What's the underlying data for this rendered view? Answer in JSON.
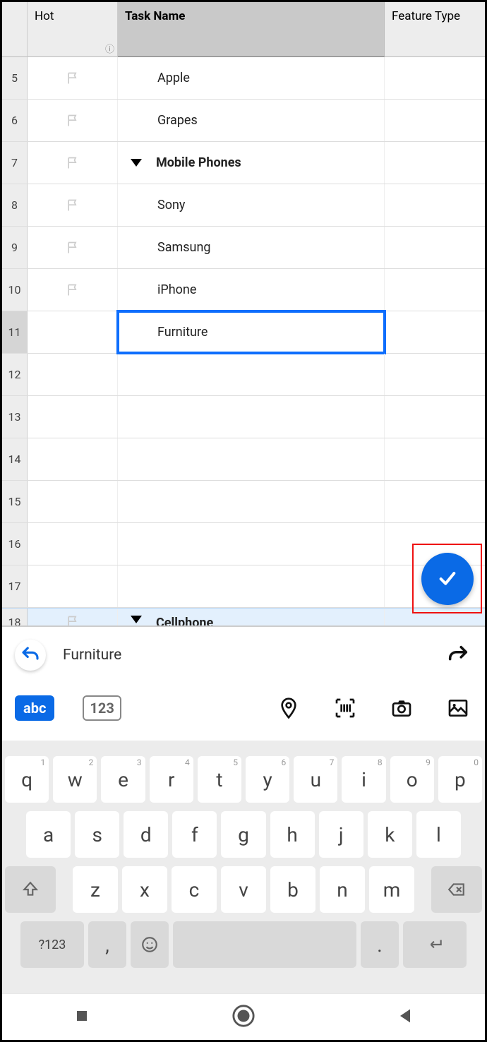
{
  "headers": {
    "hot": "Hot",
    "task": "Task Name",
    "feature": "Feature Type"
  },
  "rows": [
    {
      "num": "5",
      "flag": true,
      "indent": true,
      "text": "Apple"
    },
    {
      "num": "6",
      "flag": true,
      "indent": true,
      "text": "Grapes"
    },
    {
      "num": "7",
      "flag": true,
      "group": true,
      "text": "Mobile Phones"
    },
    {
      "num": "8",
      "flag": true,
      "indent": true,
      "text": "Sony"
    },
    {
      "num": "9",
      "flag": true,
      "indent": true,
      "text": "Samsung"
    },
    {
      "num": "10",
      "flag": true,
      "indent": true,
      "text": "iPhone"
    },
    {
      "num": "11",
      "flag": false,
      "indent": true,
      "text": "Furniture",
      "selected": true
    },
    {
      "num": "12",
      "text": ""
    },
    {
      "num": "13",
      "text": ""
    },
    {
      "num": "14",
      "text": ""
    },
    {
      "num": "15",
      "text": ""
    },
    {
      "num": "16",
      "text": ""
    },
    {
      "num": "17",
      "text": ""
    }
  ],
  "newrow": {
    "num": "18",
    "text": "Cellphone"
  },
  "input": {
    "text": "Furniture",
    "abc": "abc",
    "num123": "123"
  },
  "keyboard": {
    "r1": [
      {
        "k": "q",
        "s": "1"
      },
      {
        "k": "w",
        "s": "2"
      },
      {
        "k": "e",
        "s": "3"
      },
      {
        "k": "r",
        "s": "4"
      },
      {
        "k": "t",
        "s": "5"
      },
      {
        "k": "y",
        "s": "6"
      },
      {
        "k": "u",
        "s": "7"
      },
      {
        "k": "i",
        "s": "8"
      },
      {
        "k": "o",
        "s": "9"
      },
      {
        "k": "p",
        "s": "0"
      }
    ],
    "r2": [
      "a",
      "s",
      "d",
      "f",
      "g",
      "h",
      "j",
      "k",
      "l"
    ],
    "r3": [
      "z",
      "x",
      "c",
      "v",
      "b",
      "n",
      "m"
    ],
    "sym": "?123",
    "comma": ",",
    "period": "."
  }
}
